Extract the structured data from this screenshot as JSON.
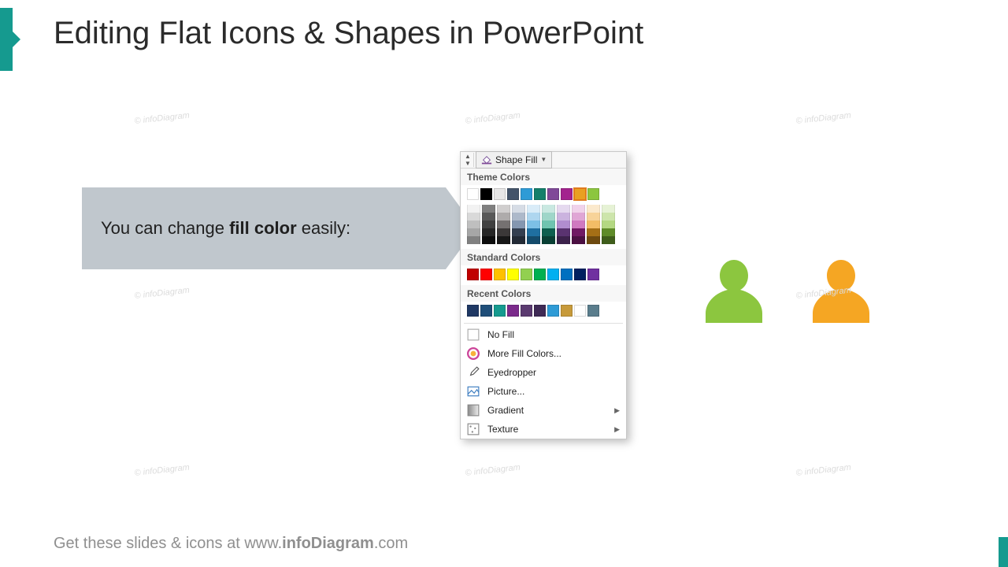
{
  "title": "Editing Flat Icons & Shapes in PowerPoint",
  "callout": {
    "prefix": "You can change ",
    "bold": "fill color",
    "suffix": " easily:"
  },
  "panel": {
    "button_label": "Shape Fill",
    "section_theme": "Theme Colors",
    "section_standard": "Standard Colors",
    "section_recent": "Recent Colors",
    "no_fill": "No Fill",
    "more_colors": "More Fill Colors...",
    "eyedropper": "Eyedropper",
    "picture": "Picture...",
    "gradient": "Gradient",
    "texture": "Texture",
    "theme_row": [
      "#ffffff",
      "#000000",
      "#e7e6e6",
      "#44546a",
      "#2e9bd6",
      "#137f6a",
      "#804998",
      "#a3238e",
      "#e9a022",
      "#8cc63f"
    ],
    "theme_shades": [
      [
        "#f2f2f2",
        "#7f7f7f",
        "#d0cece",
        "#d6dce5",
        "#d9ecf8",
        "#c9e8e1",
        "#e5d9ef",
        "#f0d2ea",
        "#fbe9cc",
        "#e6f2d5"
      ],
      [
        "#d9d9d9",
        "#595959",
        "#aeabab",
        "#adb9ca",
        "#aed6ef",
        "#9fd6c9",
        "#cbb3df",
        "#e0a6d5",
        "#f7d399",
        "#cde5ab"
      ],
      [
        "#bfbfbf",
        "#404040",
        "#757171",
        "#8497b0",
        "#7cc0e6",
        "#6fc4b0",
        "#b18dcf",
        "#d079c0",
        "#f3bd66",
        "#b4d882"
      ],
      [
        "#a6a6a6",
        "#262626",
        "#3b3838",
        "#333f50",
        "#1f6fa0",
        "#0e5f4f",
        "#5a3370",
        "#701963",
        "#a56f16",
        "#5f8b29"
      ],
      [
        "#808080",
        "#0d0d0d",
        "#171717",
        "#222a35",
        "#144b6b",
        "#093f34",
        "#3c224b",
        "#4b1042",
        "#6e4a0f",
        "#3f5d1b"
      ]
    ],
    "standard_row": [
      "#c00000",
      "#ff0000",
      "#ffc000",
      "#ffff00",
      "#92d050",
      "#00b050",
      "#00b0f0",
      "#0070c0",
      "#002060",
      "#7030a0"
    ],
    "recent_row": [
      "#1f3864",
      "#1f4e79",
      "#159a8f",
      "#7b2a8b",
      "#5b3a70",
      "#3f2a55",
      "#2e9bd6",
      "#c79a3a",
      "#ffffff",
      "#5a7d8c"
    ],
    "selected_index_theme": 8,
    "accent_color_green": "#8cc63f",
    "accent_color_orange": "#f5a623"
  },
  "footer": {
    "prefix": "Get these slides & icons at www.",
    "bold": "infoDiagram",
    "suffix": ".com"
  },
  "watermark": "© infoDiagram"
}
